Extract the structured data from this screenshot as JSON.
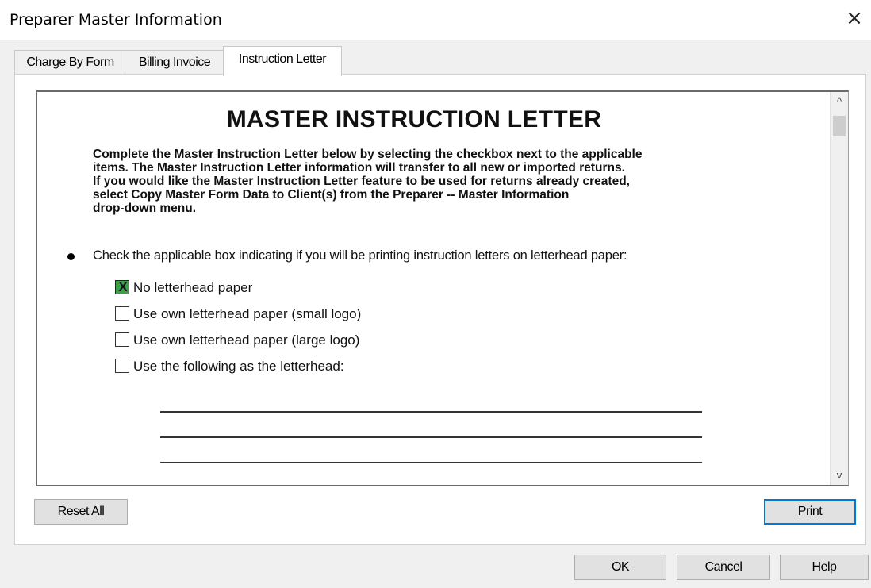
{
  "window": {
    "title": "Preparer Master Information",
    "close_icon": "×"
  },
  "tabs": [
    {
      "label": "Charge By Form",
      "active": false
    },
    {
      "label": "Billing Invoice",
      "active": false
    },
    {
      "label": "Instruction Letter",
      "active": true
    }
  ],
  "letter": {
    "heading": "MASTER INSTRUCTION LETTER",
    "intro_lines": [
      "Complete the Master Instruction Letter below by selecting the checkbox next to the applicable",
      "items.  The Master Instruction Letter information will transfer to all new or imported returns.",
      "If you would like the Master Instruction Letter feature to be used for returns already created,",
      "select Copy Master Form Data to Client(s) from the Preparer -- Master Information",
      "drop-down menu."
    ],
    "question": "Check the applicable box indicating if you will be printing instruction letters on letterhead paper:",
    "options": [
      {
        "label": "No letterhead paper",
        "checked": true,
        "mark": "X"
      },
      {
        "label": "Use own letterhead paper (small logo)",
        "checked": false,
        "mark": ""
      },
      {
        "label": "Use own letterhead paper (large logo)",
        "checked": false,
        "mark": ""
      },
      {
        "label": "Use the following as the letterhead:",
        "checked": false,
        "mark": ""
      }
    ],
    "letterhead_lines": [
      "",
      "",
      ""
    ]
  },
  "scrollbar": {
    "up_icon": "^",
    "down_icon": "v"
  },
  "buttons": {
    "reset_all": "Reset All",
    "print": "Print",
    "ok": "OK",
    "cancel": "Cancel",
    "help": "Help"
  },
  "colors": {
    "checked_box": "#3aa04a",
    "default_button_border": "#0078d7"
  }
}
